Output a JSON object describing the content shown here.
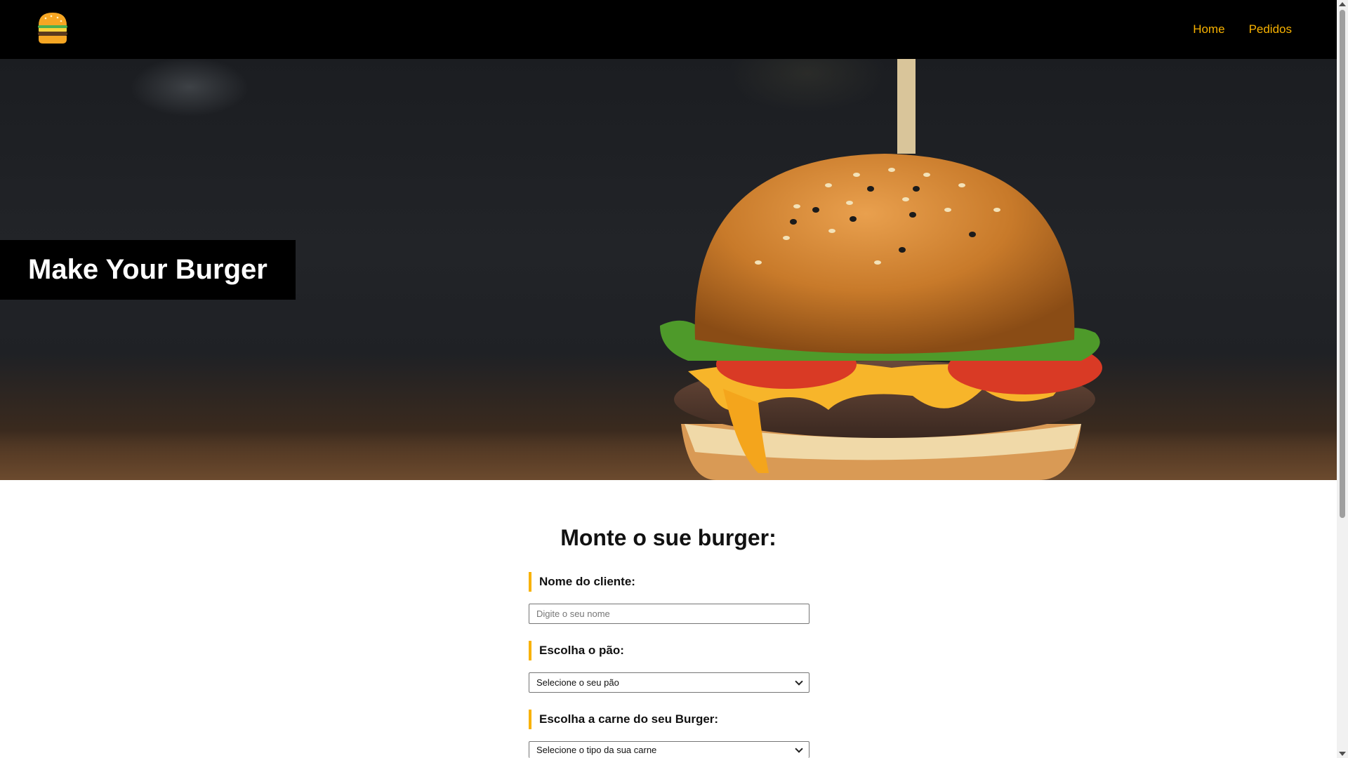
{
  "navbar": {
    "logo_icon": "burger-logo-icon",
    "links": [
      {
        "label": "Home"
      },
      {
        "label": "Pedidos"
      }
    ],
    "link_color": "#f8b200"
  },
  "hero": {
    "title": "Make Your Burger",
    "image": "burger-photo"
  },
  "form": {
    "title": "Monte o sue burger:",
    "name_field": {
      "label": "Nome do cliente:",
      "placeholder": "Digite o seu nome",
      "value": ""
    },
    "bread_field": {
      "label": "Escolha o pão:",
      "selected": "Selecione o seu pão"
    },
    "meat_field": {
      "label": "Escolha a carne do seu Burger:",
      "selected": "Selecione o tipo da sua carne"
    },
    "accent_color": "#f8b200"
  }
}
